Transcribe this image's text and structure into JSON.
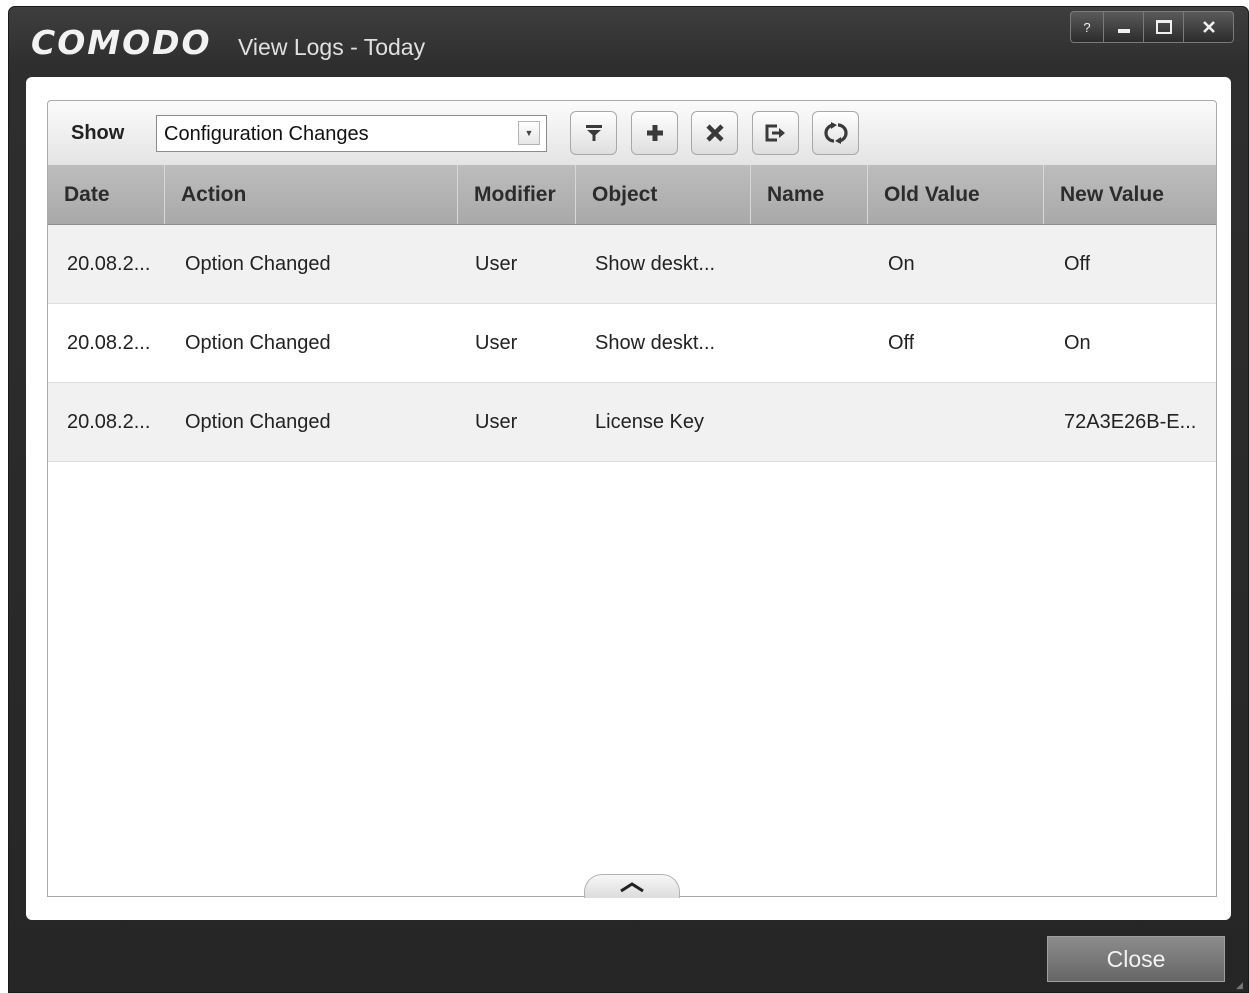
{
  "window": {
    "logo": "COMODO",
    "title": "View Logs - Today",
    "help_label": "?"
  },
  "toolbar": {
    "show_label": "Show",
    "filter_selected": "Configuration Changes",
    "buttons": [
      "filter-icon",
      "add-icon",
      "delete-icon",
      "export-icon",
      "refresh-icon"
    ]
  },
  "table": {
    "columns": [
      "Date",
      "Action",
      "Modifier",
      "Object",
      "Name",
      "Old Value",
      "New Value"
    ],
    "rows": [
      {
        "date": "20.08.2...",
        "action": "Option Changed",
        "modifier": "User",
        "object": "Show deskt...",
        "name": "",
        "old_value": "On",
        "new_value": "Off"
      },
      {
        "date": "20.08.2...",
        "action": "Option Changed",
        "modifier": "User",
        "object": "Show deskt...",
        "name": "",
        "old_value": "Off",
        "new_value": "On"
      },
      {
        "date": "20.08.2...",
        "action": "Option Changed",
        "modifier": "User",
        "object": "License Key",
        "name": "",
        "old_value": "",
        "new_value": "72A3E26B-E..."
      }
    ]
  },
  "footer": {
    "close_label": "Close"
  }
}
